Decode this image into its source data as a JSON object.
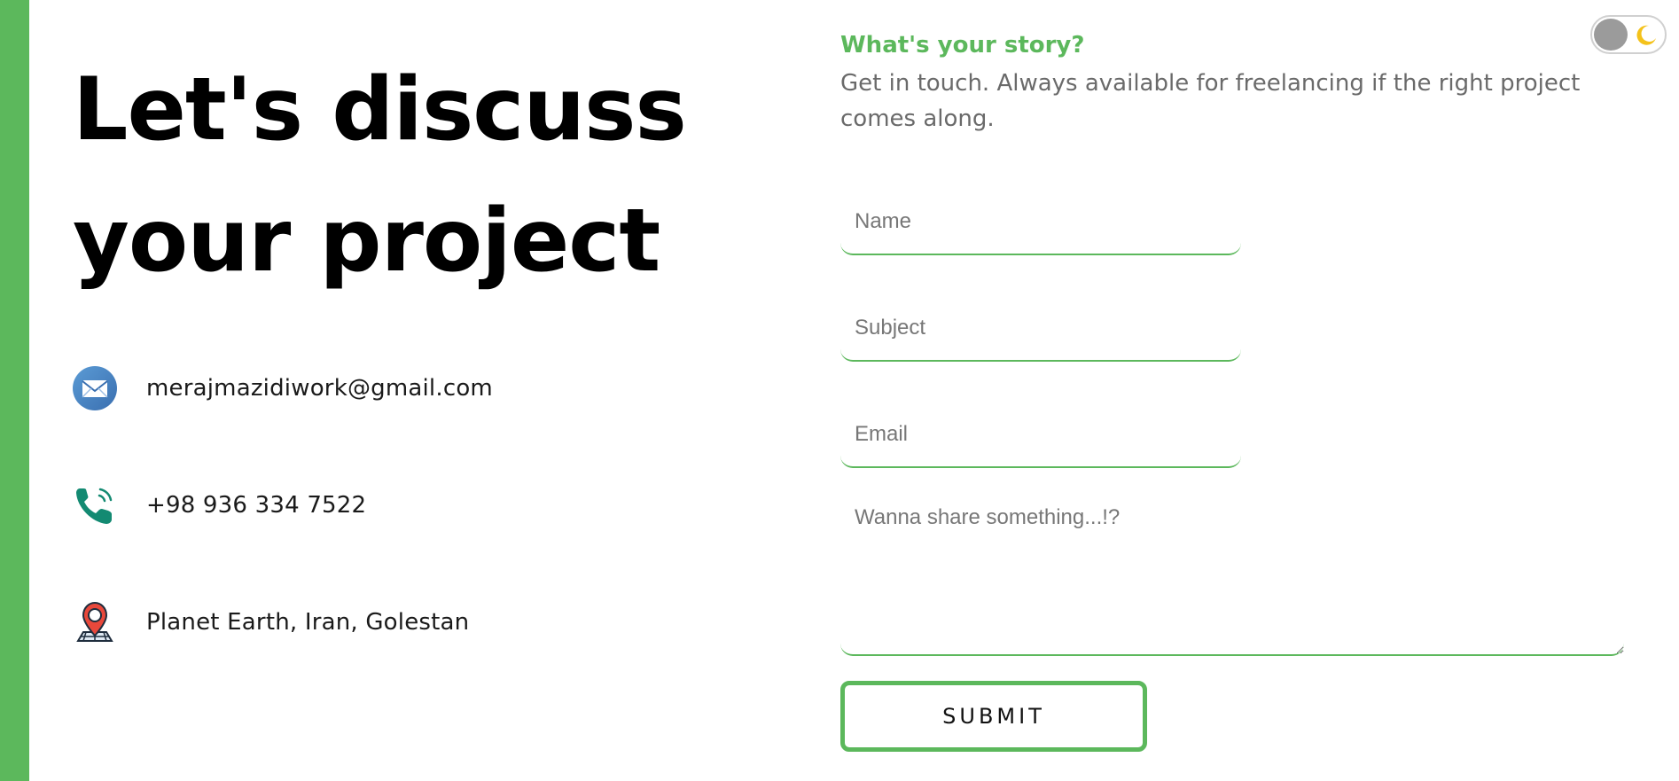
{
  "heading": {
    "line1": "Let's discuss",
    "line2": "your project"
  },
  "contacts": {
    "email": {
      "icon": "mail-icon",
      "text": "merajmazidiwork@gmail.com"
    },
    "phone": {
      "icon": "phone-icon",
      "text": "+98 936 334 7522"
    },
    "location": {
      "icon": "map-pin-icon",
      "text": "Planet Earth, Iran, Golestan"
    }
  },
  "story": {
    "title": "What's your story?",
    "description": "Get in touch. Always available for freelancing if the right project comes along."
  },
  "form": {
    "name_placeholder": "Name",
    "subject_placeholder": "Subject",
    "email_placeholder": "Email",
    "message_placeholder": "Wanna share something...!?",
    "submit_label": "SUBMIT"
  },
  "theme_toggle": {
    "icon": "moon-icon",
    "state": "light"
  },
  "colors": {
    "accent": "#5cb85c",
    "heading": "#000000",
    "muted_text": "#6a6a6a"
  }
}
